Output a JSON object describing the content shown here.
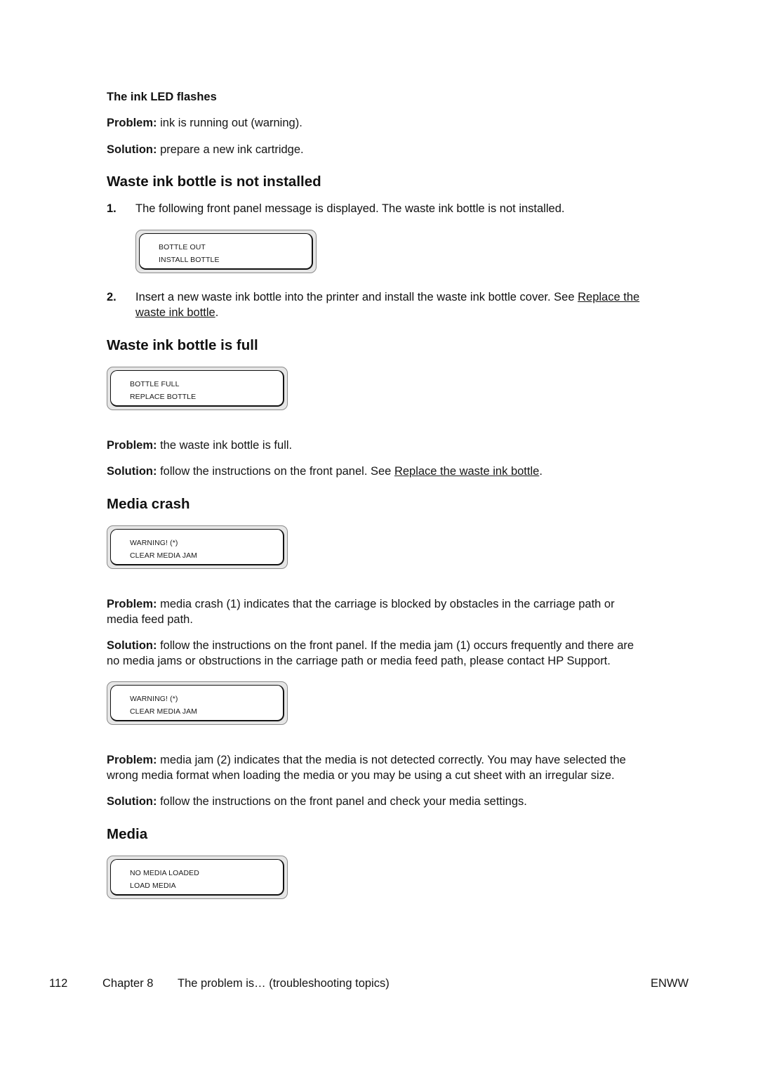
{
  "sections": {
    "ink_led": {
      "title": "The ink LED flashes",
      "problem_label": "Problem:",
      "problem_text": " ink is running out (warning).",
      "solution_label": "Solution:",
      "solution_text": " prepare a new ink cartridge."
    },
    "not_installed": {
      "heading": "Waste ink bottle is not installed",
      "step1_number": "1.",
      "step1_text": "The following front panel message is displayed. The waste ink bottle is not installed.",
      "panel": {
        "line1": "BOTTLE OUT",
        "line2": "INSTALL BOTTLE"
      },
      "step2_number": "2.",
      "step2_text": "Insert a new waste ink bottle into the printer and install the waste ink bottle cover. See ",
      "step2_link_part1": "Replace the",
      "step2_link_part2": "waste ink bottle",
      "step2_end": "."
    },
    "full": {
      "heading": "Waste ink bottle is full",
      "panel": {
        "line1": "BOTTLE FULL",
        "line2": "REPLACE BOTTLE"
      },
      "problem_label": "Problem:",
      "problem_text": " the waste ink bottle is full.",
      "solution_label": "Solution:",
      "solution_text": " follow the instructions on the front panel. See ",
      "solution_link": "Replace the waste ink bottle",
      "solution_end": "."
    },
    "media_crash": {
      "heading": "Media crash",
      "panel1": {
        "line1": "WARNING! (*)",
        "line2": "CLEAR MEDIA JAM"
      },
      "problem1_label": "Problem:",
      "problem1_line1": " media crash (1) indicates that the carriage is blocked by obstacles in the carriage path or",
      "problem1_line2": "media feed path.",
      "solution1_label": "Solution:",
      "solution1_line1": " follow the instructions on the front panel. If the media jam (1) occurs frequently and there are",
      "solution1_line2": "no media jams or obstructions in the carriage path or media feed path, please contact HP Support.",
      "panel2": {
        "line1": "WARNING! (*)",
        "line2": "CLEAR MEDIA JAM"
      },
      "problem2_label": "Problem:",
      "problem2_line1": " media jam (2) indicates that the media is not detected correctly. You may have selected the",
      "problem2_line2": "wrong media format when loading the media or you may be using a cut sheet with an irregular size.",
      "solution2_label": "Solution:",
      "solution2_text": " follow the instructions on the front panel and check your media settings."
    },
    "media": {
      "heading": "Media",
      "panel": {
        "line1": "NO MEDIA LOADED",
        "line2": "LOAD MEDIA"
      }
    }
  },
  "footer": {
    "page_number": "112",
    "chapter": "Chapter 8",
    "chapter_title": "The problem is… (troubleshooting topics)",
    "locale": "ENWW"
  }
}
